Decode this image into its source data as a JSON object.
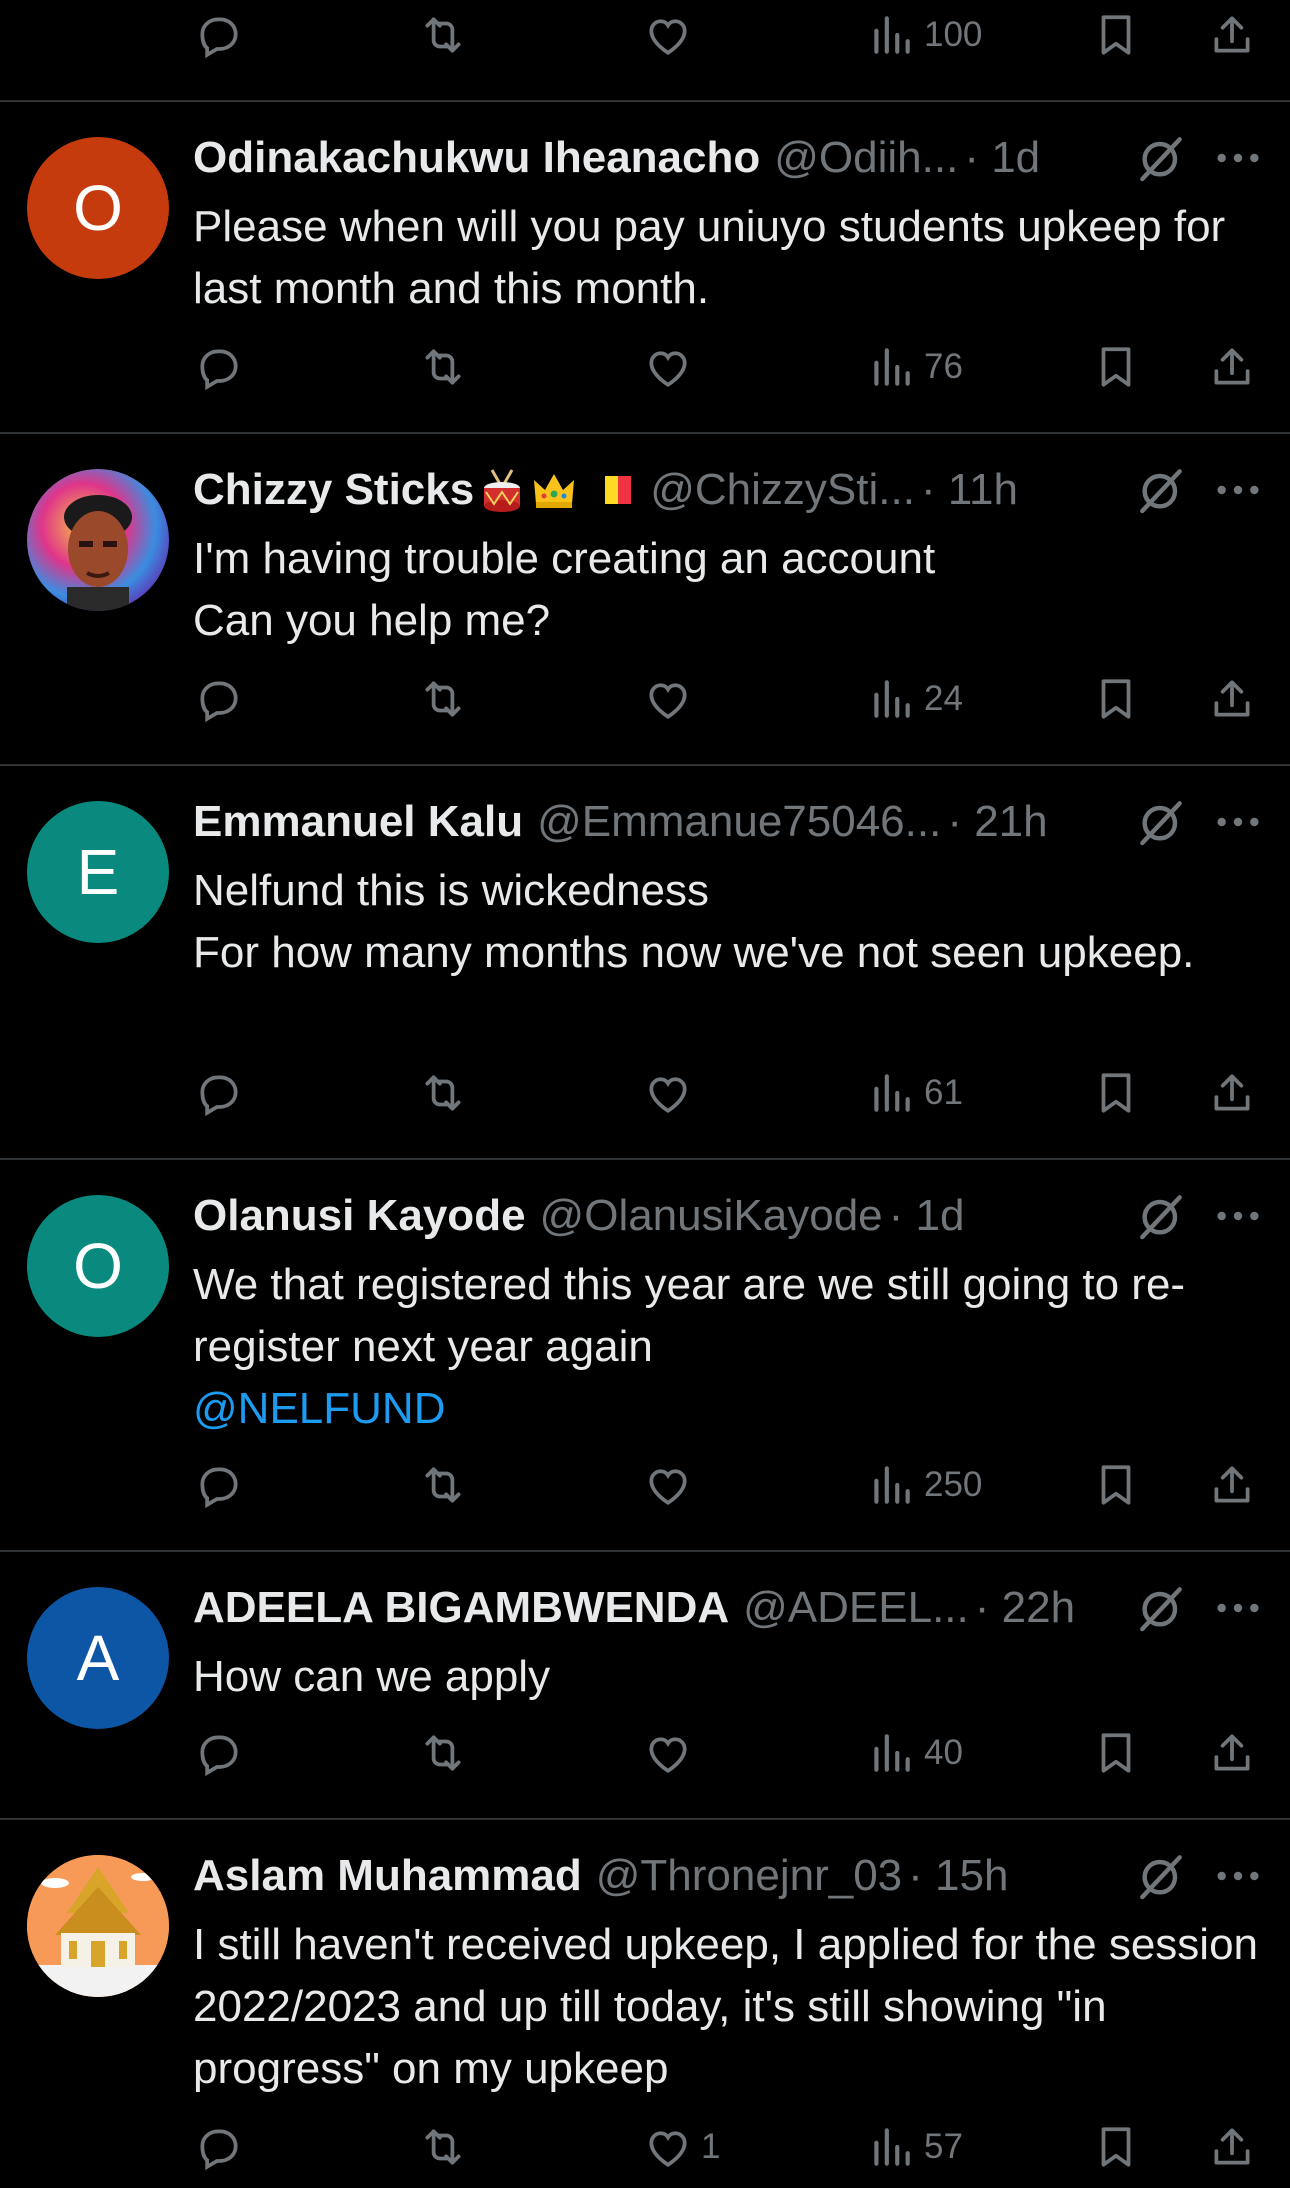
{
  "icons": {
    "reply": "reply-icon",
    "repost": "repost-icon",
    "like": "heart-icon",
    "views": "views-icon",
    "bookmark": "bookmark-icon",
    "share": "share-icon",
    "grok": "grok-icon",
    "more": "more-icon"
  },
  "top_actions": {
    "views": "100"
  },
  "tweets": [
    {
      "avatar_letter": "O",
      "avatar_color": "#c53b0e",
      "name": "Odinakachukwu Iheanacho",
      "handle": "@Odiih...",
      "time": "· 1d",
      "text": "Please when will you pay uniuyo students upkeep for last month and this month.",
      "likes": "",
      "views": "76"
    },
    {
      "avatar_letter": "",
      "avatar_color": "#5a1a86",
      "name": "Chizzy Sticks",
      "emojis": [
        "drum",
        "crown",
        "belgian-flag"
      ],
      "handle": "@ChizzySti...",
      "time": "· 11h",
      "text": "I'm having trouble creating an account\nCan you help me?",
      "likes": "",
      "views": "24"
    },
    {
      "avatar_letter": "E",
      "avatar_color": "#0a8a7e",
      "name": "Emmanuel Kalu",
      "handle": "@Emmanue75046...",
      "time": "· 21h",
      "text": "Nelfund this is wickedness\nFor how many months now we've not seen upkeep.",
      "likes": "",
      "views": "61"
    },
    {
      "avatar_letter": "O",
      "avatar_color": "#0a8a7e",
      "name": "Olanusi Kayode",
      "handle": "@OlanusiKayode",
      "time": "· 1d",
      "text": "We that registered this year are we still going to re-register next year again",
      "mention": "@NELFUND",
      "likes": "",
      "views": "250"
    },
    {
      "avatar_letter": "A",
      "avatar_color": "#0d56a5",
      "name": "ADEELA BIGAMBWENDA",
      "handle": "@ADEEL...",
      "time": "· 22h",
      "text": "How can we apply",
      "likes": "",
      "views": "40"
    },
    {
      "avatar_letter": "",
      "avatar_color": "#f79a57",
      "name": "Aslam Muhammad",
      "handle": "@Thronejnr_03",
      "time": "· 15h",
      "text": "I still haven't received upkeep, I applied for the session 2022/2023 and up till today, it's still showing \"in progress\" on my upkeep",
      "likes": "1",
      "views": "57"
    }
  ]
}
